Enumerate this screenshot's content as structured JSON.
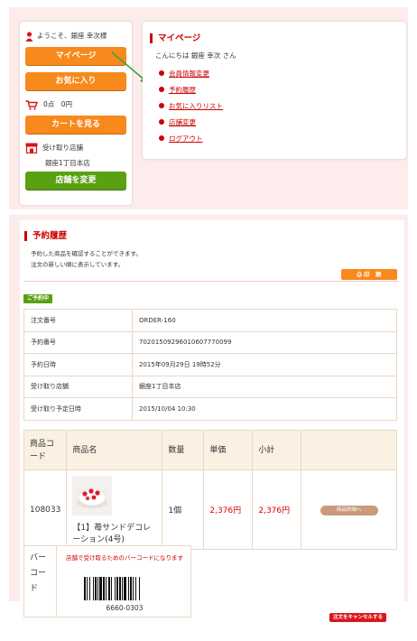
{
  "header": {
    "welcome": "ようこそ、銀座 幸次様",
    "mypage_label": "マイページ",
    "favorites_label": "お気に入り",
    "cart_summary": "0点　0円",
    "view_cart_label": "カートを見る",
    "store_heading": "受け取り店舗",
    "store_name": "銀座1丁目本店",
    "change_store_label": "店舗を変更"
  },
  "mypage": {
    "title": "マイページ",
    "greeting": "こんにちは 銀座 幸次 さん",
    "links": [
      "会員情報変更",
      "予約履歴",
      "お気に入りリスト",
      "店舗変更",
      "ログアウト"
    ]
  },
  "reservation": {
    "title": "予約履歴",
    "desc_line1": "予約した商品を確認することができます。",
    "desc_line2": "注文の新しい順に表示しています。",
    "print_label": "印　刷",
    "status_badge": "ご予約中",
    "info": [
      {
        "key": "注文番号",
        "value": "ORDER-160"
      },
      {
        "key": "予約番号",
        "value": "70201509296010607770099"
      },
      {
        "key": "予約日時",
        "value": "2015年09月29日 19時52分"
      },
      {
        "key": "受け取り店舗",
        "value": "銀座1丁目本店"
      },
      {
        "key": "受け取り予定日時",
        "value": "2015/10/04 10:30"
      }
    ],
    "item_headers": {
      "code": "商品コード",
      "name": "商品名",
      "qty": "数量",
      "unit_price": "単価",
      "subtotal": "小計"
    },
    "item": {
      "code": "108033",
      "name": "【1】苺サンドデコレーション(4号)",
      "qty": "1個",
      "unit_price": "2,376円",
      "subtotal": "2,376円",
      "detail_label": "商品詳細へ"
    },
    "barcode": {
      "label": "バーコード",
      "note": "店舗で受け取るためのバーコードになります",
      "number": "6660-0303"
    },
    "cancel_label": "注文をキャンセルする"
  },
  "colors": {
    "accent_orange": "#f7891d",
    "accent_green": "#59a112",
    "accent_red": "#cc0000",
    "page_pink": "#fdecec"
  }
}
